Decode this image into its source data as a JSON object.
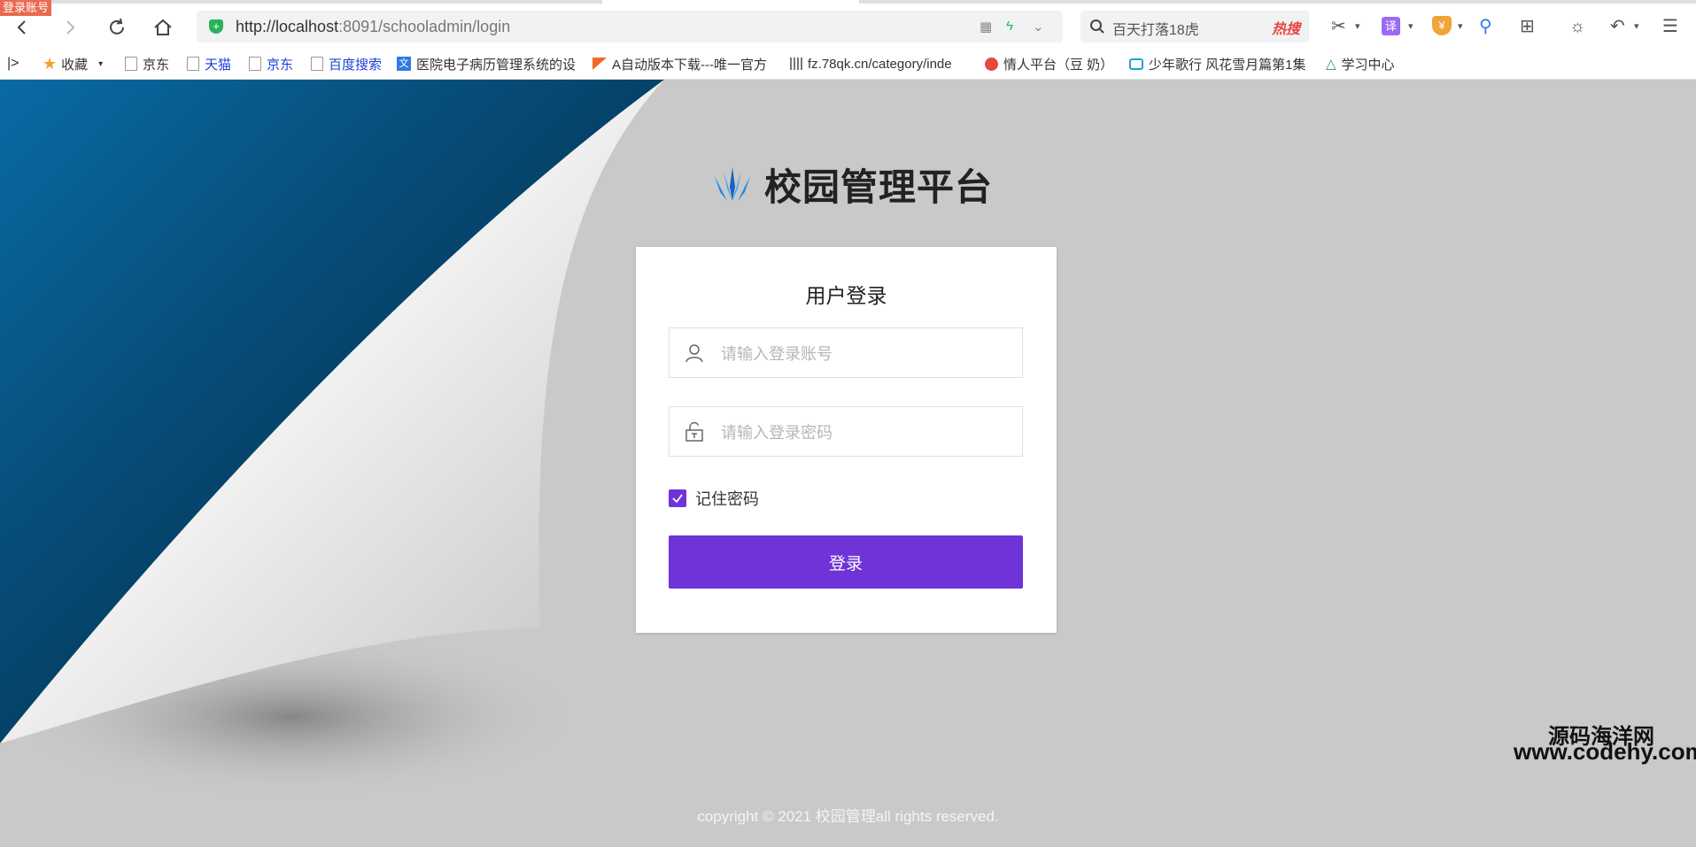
{
  "browser": {
    "title_badge": "登录账号",
    "url_host": "http://localhost",
    "url_rest": ":8091/schooladmin/login",
    "search_query": "百天打落18虎",
    "hot_label": "热搜",
    "translate_label": "译",
    "bookmarks": [
      {
        "label": "收藏",
        "icon": "star-icon"
      },
      {
        "label": "京东",
        "icon": "page-icon"
      },
      {
        "label": "天猫",
        "icon": "page-icon"
      },
      {
        "label": "京东",
        "icon": "page-icon"
      },
      {
        "label": "百度搜索",
        "icon": "page-icon"
      },
      {
        "label": "医院电子病历管理系统的设",
        "icon": "site-icon"
      },
      {
        "label": "A自动版本下载---唯一官方",
        "icon": "site-icon"
      },
      {
        "label": "fz.78qk.cn/category/inde",
        "icon": "site-icon"
      },
      {
        "label": "情人平台（豆 奶）",
        "icon": "site-icon"
      },
      {
        "label": "少年歌行 风花雪月篇第1集",
        "icon": "site-icon"
      },
      {
        "label": "学习中心",
        "icon": "site-icon"
      }
    ]
  },
  "app": {
    "title": "校园管理平台",
    "login": {
      "heading": "用户登录",
      "username_placeholder": "请输入登录账号",
      "password_placeholder": "请输入登录密码",
      "remember_label": "记住密码",
      "remember_checked": true,
      "submit_label": "登录"
    },
    "footer": "copyright © 2021 校园管理all rights reserved."
  },
  "watermark": {
    "line1": "源码海洋网",
    "line2": "www.codehy.com"
  },
  "colors": {
    "accent": "#6f33d7",
    "background": "#c9c9c9",
    "logo_blue": "#1e88e5"
  }
}
